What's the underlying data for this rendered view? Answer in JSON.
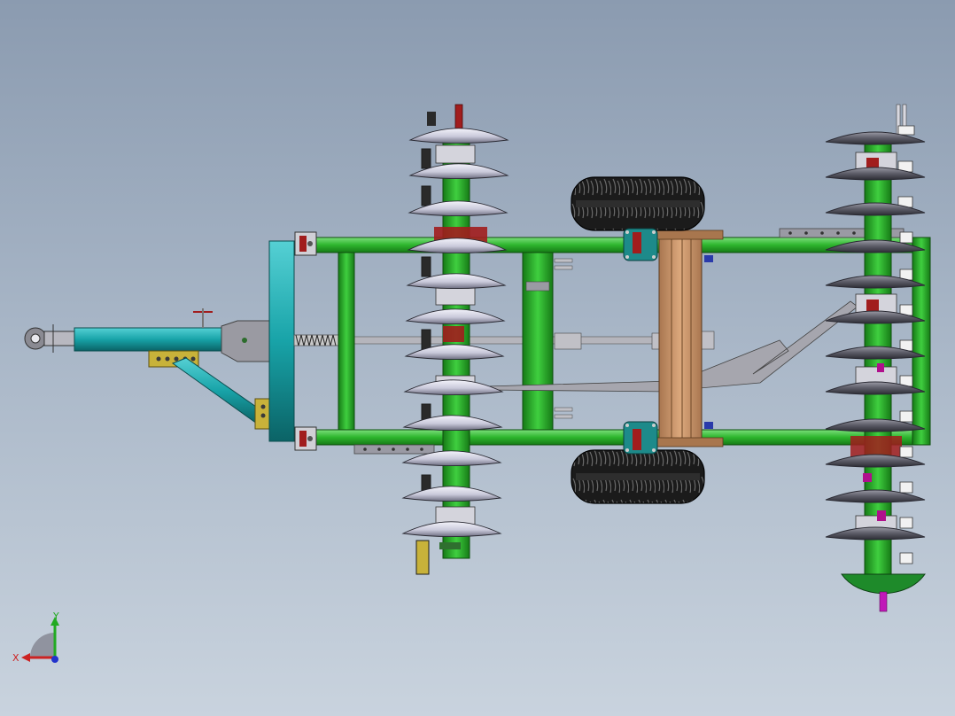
{
  "triad": {
    "x_label": "X",
    "y_label": "Y"
  },
  "colors": {
    "frame": "#2db52d",
    "frame_dark": "#1a7a1a",
    "drawbar": "#18a3a8",
    "drawbar_dark": "#0d6d70",
    "disc": "#c9c9d8",
    "disc_dark": "#5a5a6a",
    "disc_rear": "#4a4a55",
    "tire": "#202020",
    "wood": "#c7956a",
    "bracket": "#a11d1d",
    "hitch_plate": "#c8b23a",
    "gray_part": "#a0a0a8",
    "end_cap": "#1e8a2a"
  }
}
